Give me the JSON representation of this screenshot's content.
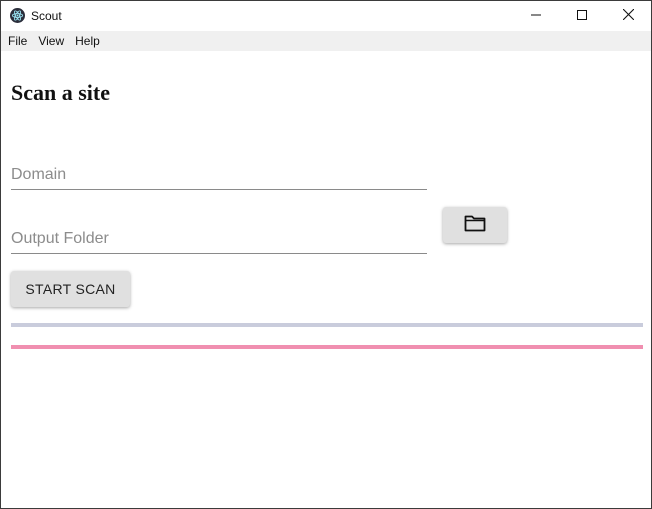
{
  "window": {
    "title": "Scout",
    "controls": {
      "minimize": "minimize",
      "maximize": "maximize",
      "close": "close"
    }
  },
  "menu": {
    "items": [
      "File",
      "View",
      "Help"
    ]
  },
  "main": {
    "heading": "Scan a site",
    "domain_placeholder": "Domain",
    "domain_value": "",
    "output_placeholder": "Output Folder",
    "output_value": "",
    "start_label": "START SCAN"
  },
  "colors": {
    "progress_primary": "#c9ccdc",
    "progress_secondary": "#f08fb0",
    "button_bg": "#e0e0e0"
  },
  "icons": {
    "app": "electron-logo-icon",
    "folder": "folder-icon",
    "minimize": "minimize-icon",
    "maximize": "maximize-icon",
    "close": "close-icon"
  }
}
